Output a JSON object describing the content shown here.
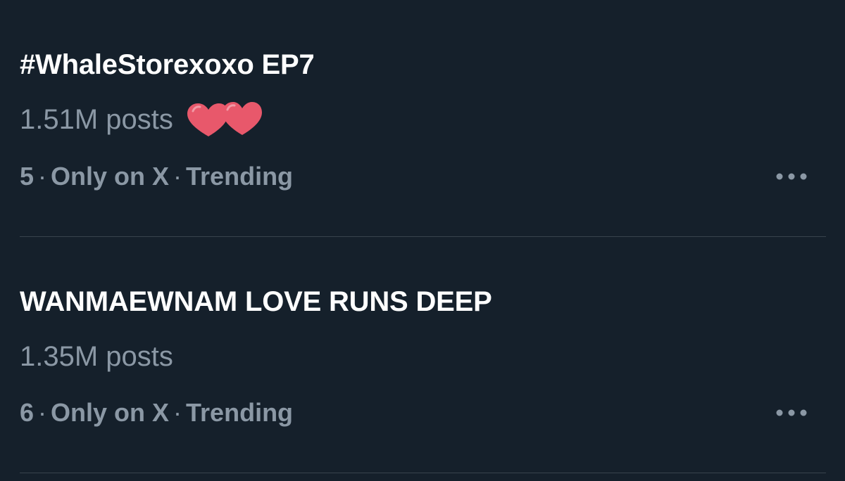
{
  "colors": {
    "background": "#15202b",
    "primary_text": "#ffffff",
    "secondary_text": "#8b98a5",
    "divider": "#38444d",
    "heart": "#e8586b"
  },
  "trends": [
    {
      "title": "#WhaleStorexoxo EP7",
      "post_count": "1.51M posts",
      "emoji": "two-hearts",
      "rank": "5",
      "context": "Only on X",
      "category": "Trending",
      "more_icon": "more-horizontal-icon"
    },
    {
      "title": "WANMAEWNAM LOVE RUNS DEEP",
      "post_count": "1.35M posts",
      "rank": "6",
      "context": "Only on X",
      "category": "Trending",
      "more_icon": "more-horizontal-icon"
    }
  ],
  "separator": "·"
}
